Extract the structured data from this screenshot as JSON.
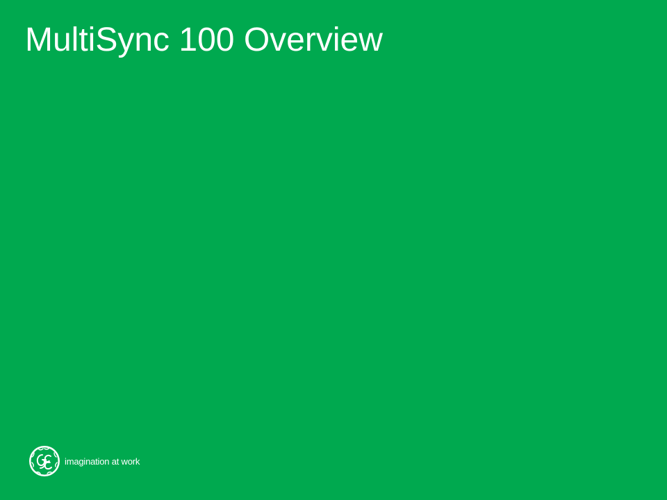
{
  "slide": {
    "title": "MultiSync 100 Overview",
    "background_color": "#00a94f",
    "text_color": "#ffffff"
  },
  "footer": {
    "logo": "ge-monogram-logo",
    "logo_text": "GE",
    "tagline": "imagination at work"
  }
}
